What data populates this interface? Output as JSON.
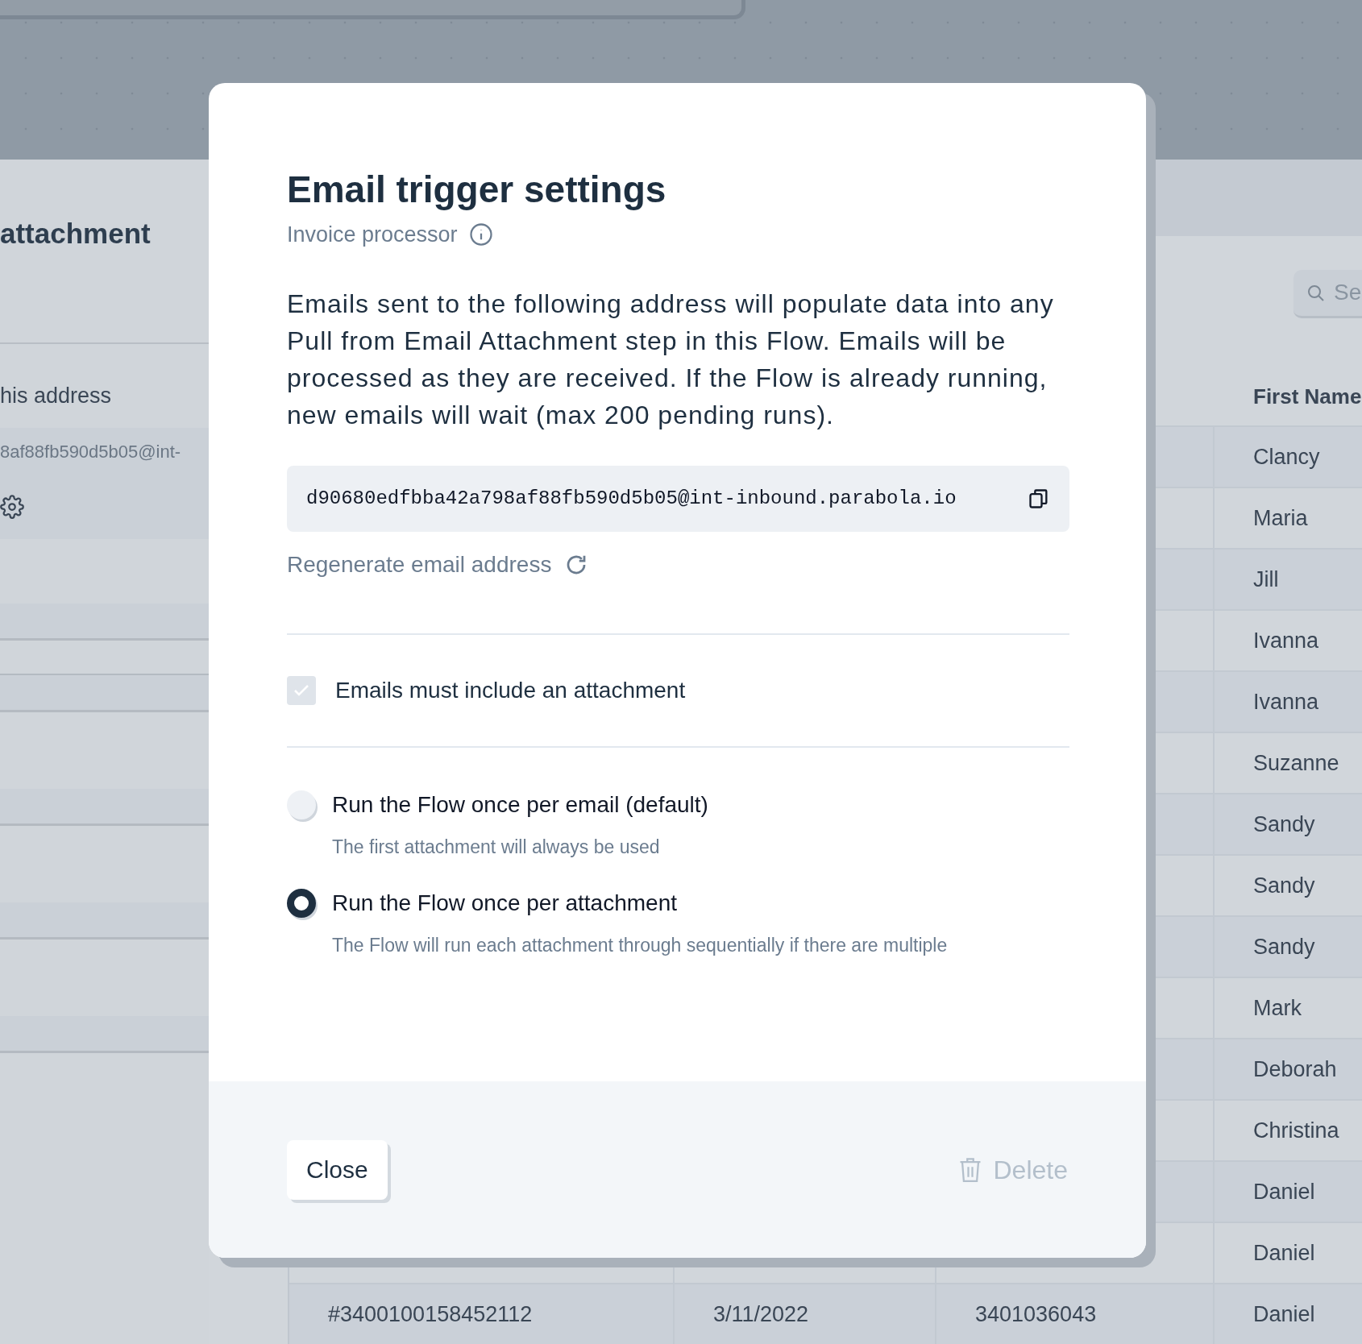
{
  "left_panel": {
    "title": "attachment",
    "address_label": "his address",
    "address_value": "8af88fb590d5b05@int-"
  },
  "search": {
    "placeholder": "Se"
  },
  "table": {
    "column_4_header": "First Name",
    "rows": [
      {
        "first_name": "Clancy"
      },
      {
        "first_name": "Maria"
      },
      {
        "first_name": "Jill"
      },
      {
        "first_name": "Ivanna"
      },
      {
        "first_name": "Ivanna"
      },
      {
        "first_name": "Suzanne"
      },
      {
        "first_name": "Sandy"
      },
      {
        "first_name": "Sandy"
      },
      {
        "first_name": "Sandy"
      },
      {
        "first_name": "Mark"
      },
      {
        "first_name": "Deborah"
      },
      {
        "first_name": "Christina"
      },
      {
        "first_name": "Daniel"
      },
      {
        "first_name": "Daniel"
      },
      {
        "first_name": "Daniel",
        "column_1": "#3400100158452112",
        "column_2": "3/11/2022",
        "column_3": "3401036043"
      }
    ]
  },
  "modal": {
    "title": "Email trigger settings",
    "subtitle": "Invoice processor",
    "description": "Emails sent to the following address will populate data into any Pull from Email Attachment step in this Flow. Emails will be processed as they are received. If the Flow is already running, new emails will wait (max 200 pending runs).",
    "email_address": "d90680edfbba42a798af88fb590d5b05@int-inbound.parabola.io",
    "regenerate_label": "Regenerate email address",
    "checkbox": {
      "label": "Emails must include an attachment",
      "checked": true,
      "disabled": true
    },
    "options": [
      {
        "label": "Run the Flow once per email (default)",
        "description": "The first attachment will always be used",
        "selected": false
      },
      {
        "label": "Run the Flow once per attachment",
        "description": "The Flow will run each attachment through sequentially if there are multiple",
        "selected": true
      }
    ],
    "close_label": "Close",
    "delete": {
      "label": "Delete",
      "disabled": true
    }
  }
}
